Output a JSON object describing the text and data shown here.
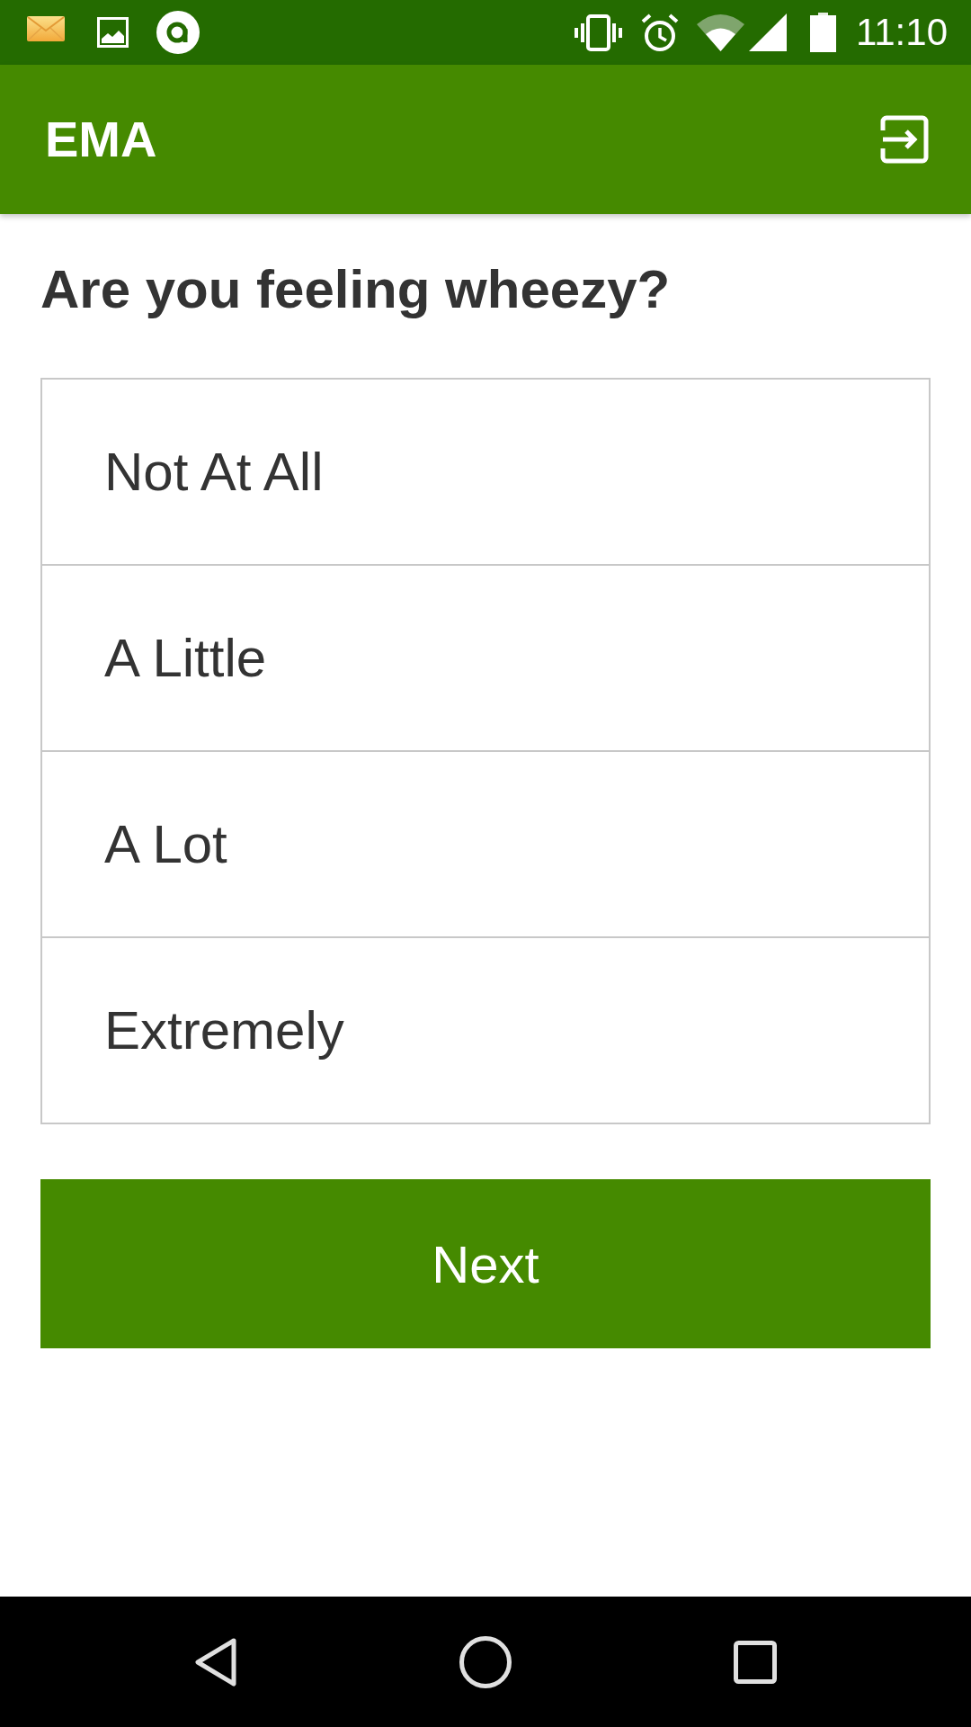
{
  "status_bar": {
    "time": "11:10"
  },
  "app_bar": {
    "title": "EMA"
  },
  "question": "Are you feeling wheezy?",
  "options": [
    {
      "label": "Not At All",
      "selected": false
    },
    {
      "label": "A Little",
      "selected": false
    },
    {
      "label": "A Lot",
      "selected": false
    },
    {
      "label": "Extremely",
      "selected": false
    }
  ],
  "next_button": {
    "label": "Next"
  }
}
